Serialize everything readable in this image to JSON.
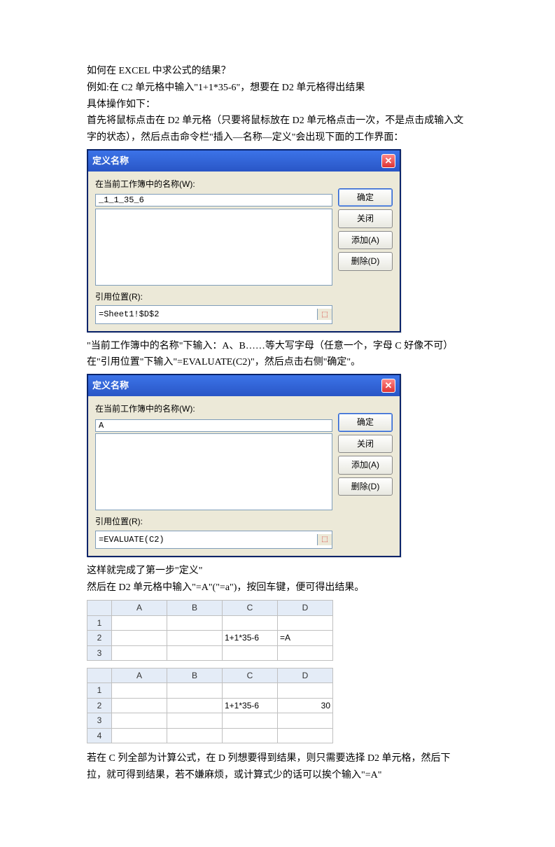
{
  "text": {
    "p1": "如何在 EXCEL 中求公式的结果？",
    "p2": "例如:在 C2 单元格中输入\"1+1*35-6\"，想要在 D2 单元格得出结果",
    "p3": "具体操作如下：",
    "p4": "首先将鼠标点击在 D2 单元格（只要将鼠标放在 D2 单元格点击一次，不是点击成输入文字的状态），然后点击命令栏\"插入—名称—定义\"会出现下面的工作界面：",
    "p5": "\"当前工作簿中的名称\"下输入：A、B……等大写字母（任意一个，字母 C 好像不可）",
    "p6": "在\"引用位置\"下输入\"=EVALUATE(C2)\"，然后点击右侧\"确定\"。",
    "p7": "这样就完成了第一步\"定义\"",
    "p8": "然后在 D2 单元格中输入\"=A\"(\"=a\")，按回车键，便可得出结果。",
    "p9": "若在 C 列全部为计算公式，在 D 列想要得到结果，则只需要选择 D2 单元格，然后下拉，就可得到结果，若不嫌麻烦，或计算式少的话可以挨个输入\"=A\""
  },
  "dialog1": {
    "title": "定义名称",
    "lbl_name": "在当前工作簿中的名称(W):",
    "name_val": "_1_1_35_6",
    "lbl_ref": "引用位置(R):",
    "ref_val": "=Sheet1!$D$2",
    "btn_ok": "确定",
    "btn_close": "关闭",
    "btn_add": "添加(A)",
    "btn_del": "删除(D)"
  },
  "dialog2": {
    "title": "定义名称",
    "lbl_name": "在当前工作簿中的名称(W):",
    "name_val": "A",
    "lbl_ref": "引用位置(R):",
    "ref_val": "=EVALUATE(C2)",
    "btn_ok": "确定",
    "btn_close": "关闭",
    "btn_add": "添加(A)",
    "btn_del": "删除(D)"
  },
  "sheet1": {
    "cols": [
      "A",
      "B",
      "C",
      "D"
    ],
    "rows": [
      "1",
      "2",
      "3"
    ],
    "c2": "1+1*35-6",
    "d2": "=A"
  },
  "sheet2": {
    "cols": [
      "A",
      "B",
      "C",
      "D"
    ],
    "rows": [
      "1",
      "2",
      "3",
      "4"
    ],
    "c2": "1+1*35-6",
    "d2": "30"
  }
}
